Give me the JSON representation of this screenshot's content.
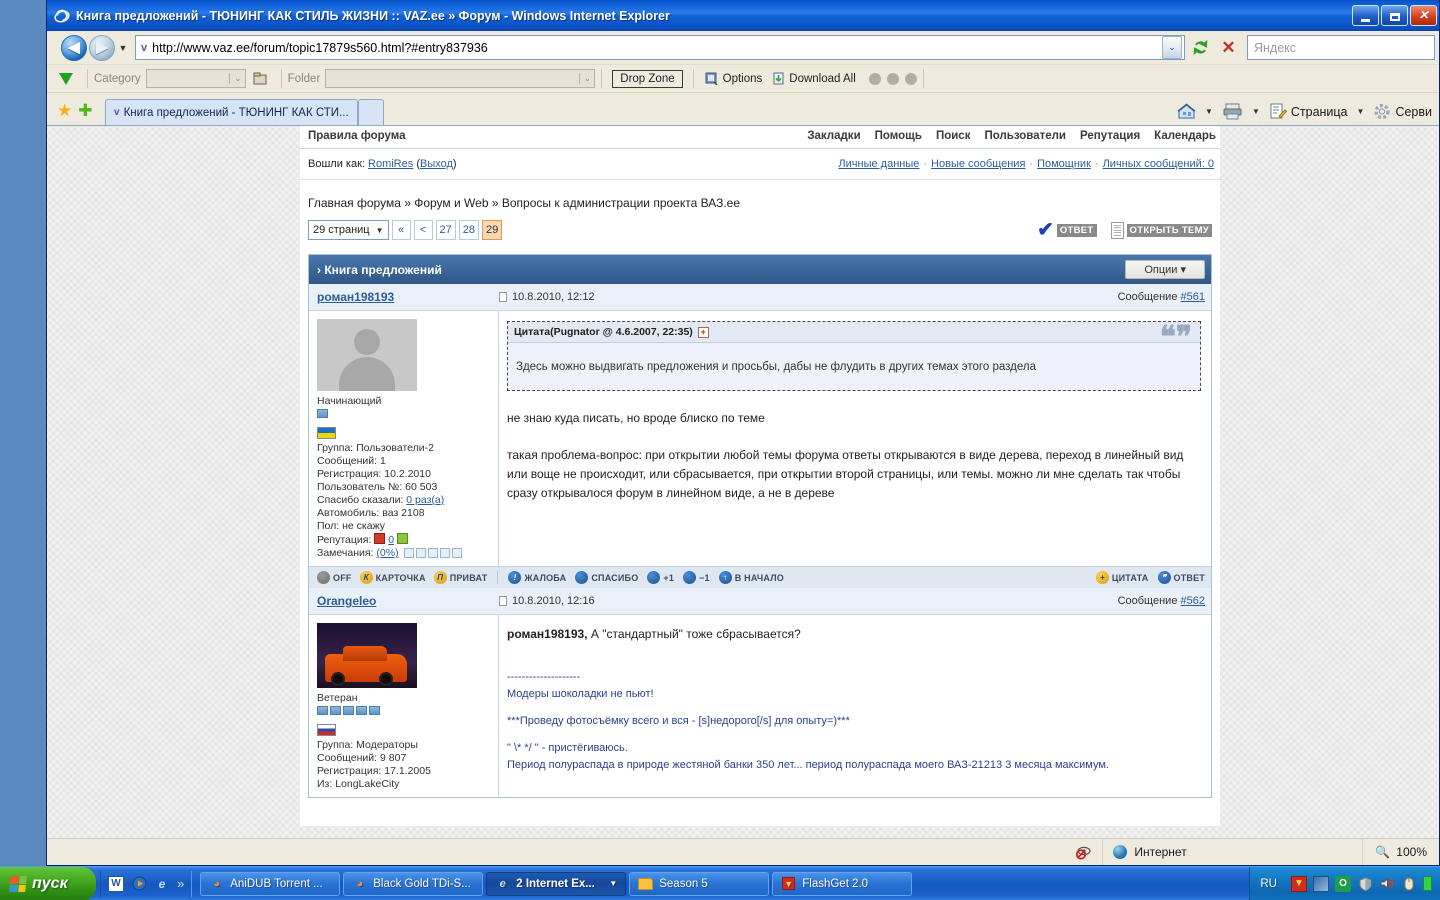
{
  "window": {
    "title": "Книга предложений - ТЮНИНГ КАК СТИЛЬ ЖИЗНИ :: VAZ.ee » Форум - Windows Internet Explorer",
    "icon": "ie-logo-icon",
    "minimize_label": "—",
    "maximize_label": "□",
    "close_label": "✕"
  },
  "address_bar": {
    "back_label": "◀",
    "forward_label": "▶",
    "history_caret": "▼",
    "url": "http://www.vaz.ee/forum/topic17879s560.html?#entry837936",
    "url_favicon": "v",
    "url_dropdown_caret": "⌄",
    "refresh_label": "⟳",
    "stop_label": "✕",
    "search_placeholder": "Яндекс"
  },
  "flashget_toolbar": {
    "category_label": "Category",
    "category_value": "",
    "folder_label": "Folder",
    "folder_value": "",
    "drop_zone_label": "Drop Zone",
    "options_label": "Options",
    "download_all_label": "Download All"
  },
  "tabs": {
    "favorites_icon": "★",
    "add_favorite_icon": "✚",
    "items": [
      {
        "label": "Книга предложений - ТЮНИНГ КАК СТИ...",
        "active": true
      }
    ],
    "new_tab_label": ""
  },
  "command_bar": {
    "home_label": "",
    "print_label": "",
    "page_label": "Страница",
    "tools_label": "Серви",
    "caret": "▼"
  },
  "forum": {
    "topnav": {
      "rules_label": "Правила форума",
      "links": [
        "Закладки",
        "Помощь",
        "Поиск",
        "Пользователи",
        "Репутация",
        "Календарь"
      ]
    },
    "loginbar": {
      "logged_as_label": "Вошли как:",
      "username": "RomiRes",
      "logout_open": "(",
      "logout_label": "Выход",
      "logout_close": ")",
      "right_links": [
        "Личные данные",
        "Новые сообщения",
        "Помощник",
        "Личных сообщений: 0"
      ]
    },
    "breadcrumb": "Главная форума » Форум и Web » Вопросы к администрации проекта ВАЗ.ee",
    "pager": {
      "select_label": "29 страниц",
      "select_caret": "▼",
      "first_label": "«",
      "prev_label": "<",
      "pages": [
        "27",
        "28"
      ],
      "current_page": "29"
    },
    "topic_actions": {
      "reply_label": "ОТВЕТ",
      "new_topic_label": "ОТКРЫТЬ ТЕМУ"
    },
    "topic": {
      "title": "Книга предложений",
      "title_arrow": "›",
      "options_label": "Опции ▾"
    },
    "posts": [
      {
        "author": "роман198193",
        "date": "10.8.2010, 12:12",
        "message_label": "Сообщение",
        "message_number": "#561",
        "avatar": "placeholder",
        "rank": "Начинающий",
        "pips": 1,
        "flag": "ua",
        "fields": [
          {
            "label": "Группа:",
            "value": "Пользователи-2"
          },
          {
            "label": "Сообщений:",
            "value": "1"
          },
          {
            "label": "Регистрация:",
            "value": "10.2.2010"
          },
          {
            "label": "Пользователь №:",
            "value": "60 503"
          },
          {
            "label": "Спасибо сказали:",
            "value": "0 раз(а)",
            "link": true
          },
          {
            "label": "Автомобиль:",
            "value": "ваз 2108"
          },
          {
            "label": "Пол:",
            "value": "не скажу"
          }
        ],
        "reputation_label": "Репутация:",
        "reputation_value": "0",
        "warnings_label": "Замечания:",
        "warnings_value": "(0%)",
        "quote": {
          "header": "Цитата(Pugnator @ 4.6.2007, 22:35)",
          "expand_icon": "+",
          "text": "Здесь можно выдвигать предложения и просьбы, дабы не флудить в других темах этого раздела",
          "marks": "❝❞"
        },
        "paragraphs": [
          "не знаю куда писать, но вроде блиско по теме",
          "такая проблема-вопрос: при открытии любой темы форума ответы открываются в виде дерева, переход в линейный вид или воще не происходит, или сбрасывается, при открытии второй страницы, или темы. можно ли мне сделать так чтобы сразу открывалося форум в линейном виде, а не в дереве"
        ],
        "tools_left": [
          {
            "label": "OFF",
            "icon": "grey"
          },
          {
            "label": "КАРТОЧКА",
            "icon": "gold",
            "glyph": "К"
          },
          {
            "label": "ПРИВАТ",
            "icon": "gold",
            "glyph": "П"
          }
        ],
        "tools_mid": [
          {
            "label": "ЖАЛОБА",
            "icon": "blue",
            "glyph": "!"
          },
          {
            "label": "СПАСИБО",
            "icon": "blue",
            "glyph": ""
          },
          {
            "label": "+1",
            "icon": "blue",
            "glyph": ""
          },
          {
            "label": "−1",
            "icon": "blue",
            "glyph": ""
          },
          {
            "label": "В НАЧАЛО",
            "icon": "blue",
            "glyph": "↑"
          }
        ],
        "tools_right": [
          {
            "label": "ЦИТАТА",
            "icon": "gold",
            "glyph": "+"
          },
          {
            "label": "ОТВЕТ",
            "icon": "blue",
            "glyph": "❞"
          }
        ]
      },
      {
        "author": "Orangeleo",
        "date": "10.8.2010, 12:16",
        "message_label": "Сообщение",
        "message_number": "#562",
        "avatar": "car-photo",
        "rank": "Ветеран",
        "pips": 5,
        "flag": "ru",
        "fields": [
          {
            "label": "Группа:",
            "value": "Модераторы"
          },
          {
            "label": "Сообщений:",
            "value": "9 807"
          },
          {
            "label": "Регистрация:",
            "value": "17.1.2005"
          },
          {
            "label": "Из:",
            "value": "LongLakeCity"
          }
        ],
        "body_mention": "роман198193,",
        "body_text": " А \"стандартный\" тоже сбрасывается?",
        "signature": [
          "--------------------",
          "Модеры шоколадки не пьют!",
          "***Проведу фотосъёмку всего и вся - [s]недорого[/s] для опыту=)***",
          "\" \\* */ \" - пристёгиваюсь.",
          "Период полураспада в природе жестяной банки 350 лет... период полураспада моего ВАЗ-21213 3 месяца максимум."
        ]
      }
    ]
  },
  "status_bar": {
    "zone_label": "Интернет",
    "zoom_label": "100%",
    "blocked_icon": "blocked-popup-icon"
  },
  "taskbar": {
    "start_label": "пуск",
    "quick_launch": [
      "word-icon",
      "media-player-icon",
      "internet-explorer-icon",
      "»"
    ],
    "tasks": [
      {
        "label": "AniDUB Torrent ...",
        "icon": "firefox-icon",
        "active": false
      },
      {
        "label": "Black Gold TDi-S...",
        "icon": "firefox-icon",
        "active": false
      },
      {
        "label": "2 Internet Ex...",
        "icon": "internet-explorer-icon",
        "active": true,
        "caret": "▼"
      },
      {
        "label": "Season 5",
        "icon": "folder-icon",
        "active": false
      },
      {
        "label": "FlashGet 2.0",
        "icon": "flashget-icon",
        "active": false
      }
    ],
    "tray": {
      "language": "RU",
      "icons": [
        "flashget-tray-icon",
        "network-icon",
        "opera-icon",
        "shield-icon",
        "volume-icon",
        "mouse-icon",
        "battery-icon"
      ]
    }
  }
}
